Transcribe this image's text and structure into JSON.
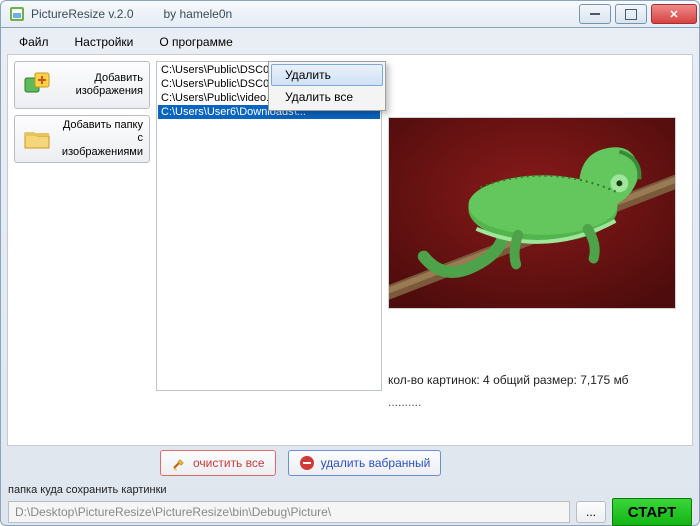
{
  "window": {
    "title": "PictureResize v.2.0         by hamele0n"
  },
  "menu": {
    "file": "Файл",
    "settings": "Настройки",
    "about": "О программе"
  },
  "sidebar": {
    "add_images": "Добавить изображения",
    "add_folder": "Добавить папку с изображениями"
  },
  "files": [
    "C:\\Users\\Public\\DSC00010.JPG",
    "C:\\Users\\Public\\DSC00011.JPG",
    "C:\\Users\\Public\\video.jpg",
    "C:\\Users\\User6\\Downloads\\..."
  ],
  "context_menu": {
    "delete": "Удалить",
    "delete_all": "Удалить все"
  },
  "actions": {
    "clear_all": "очистить все",
    "delete_selected": "удалить вабранный"
  },
  "stats": {
    "line": "кол-во картинок: 4 общий размер: 7,175 мб",
    "dots": ".........."
  },
  "save": {
    "label": "папка куда сохранить картинки",
    "path": "D:\\Desktop\\PictureResize\\PictureResize\\bin\\Debug\\Picture\\",
    "browse": "...",
    "start": "СТАРТ"
  }
}
